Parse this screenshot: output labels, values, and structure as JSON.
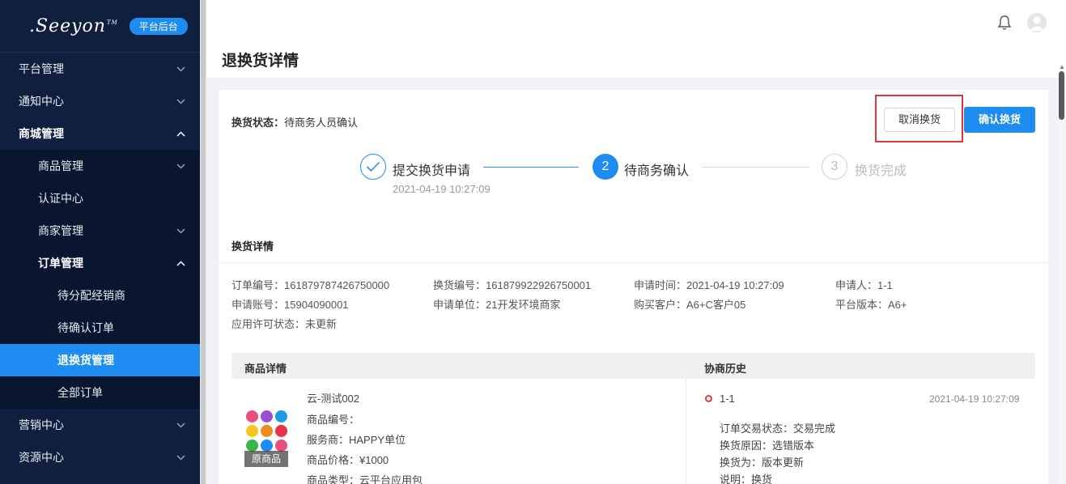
{
  "brand": {
    "logo_text": ".Seeyon",
    "tm": "TM",
    "badge": "平台后台"
  },
  "sidebar": {
    "items": [
      {
        "label": "平台管理"
      },
      {
        "label": "通知中心"
      },
      {
        "label": "商城管理"
      },
      {
        "label": "商品管理"
      },
      {
        "label": "认证中心"
      },
      {
        "label": "商家管理"
      },
      {
        "label": "订单管理"
      },
      {
        "label": "待分配经销商"
      },
      {
        "label": "待确认订单"
      },
      {
        "label": "退换货管理"
      },
      {
        "label": "全部订单"
      },
      {
        "label": "营销中心"
      },
      {
        "label": "资源中心"
      }
    ]
  },
  "header": {
    "title": "退换货详情",
    "bell_icon": "bell-icon",
    "avatar_icon": "user-avatar-icon"
  },
  "status": {
    "label": "换货状态：",
    "value": "待商务人员确认"
  },
  "actions": {
    "cancel": "取消换货",
    "confirm": "确认换货"
  },
  "steps": [
    {
      "num": "✓",
      "label": "提交换货申请",
      "time": "2021-04-19 10:27:09",
      "state": "done"
    },
    {
      "num": "2",
      "label": "待商务确认",
      "state": "active"
    },
    {
      "num": "3",
      "label": "换货完成",
      "state": "pending"
    }
  ],
  "detail": {
    "title": "换货详情",
    "fields": {
      "order_no": "订单编号：161879787426750000",
      "exchange_no": "换货编号：161879922926750001",
      "apply_time": "申请时间：2021-04-19 10:27:09",
      "applicant": "申请人：1-1",
      "account": "申请账号：15904090001",
      "unit": "申请单位：21开发环境商家",
      "customer": "购买客户：A6+C客户05",
      "version": "平台版本：A6+",
      "license": "应用许可状态：未更新"
    }
  },
  "product": {
    "header": "商品详情",
    "tag": "原商品",
    "name": "云-测试002",
    "code": "商品编号：",
    "provider": "服务商：HAPPY单位",
    "price": "商品价格：¥1000",
    "type": "商品类型：云平台应用包"
  },
  "history": {
    "header": "协商历史",
    "name": "1-1",
    "time": "2021-04-19 10:27:09",
    "lines": [
      "订单交易状态：交易完成",
      "换货原因：选错版本",
      "换货为：版本更新",
      "说明：换货"
    ]
  },
  "colors": {
    "sidebar_bg": "#0f1f3d",
    "accent": "#1e8cf0",
    "highlight": "#d9363e"
  }
}
